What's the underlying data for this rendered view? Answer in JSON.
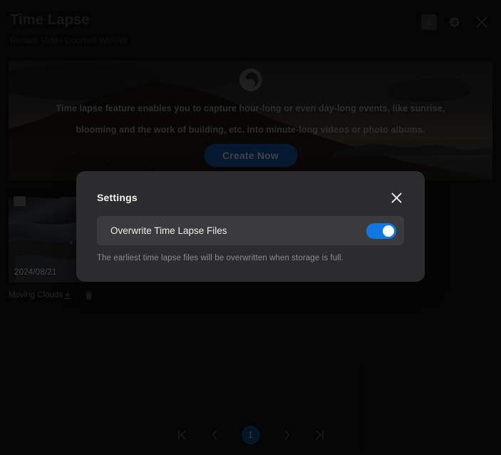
{
  "header": {
    "title": "Time Lapse",
    "subtitle": "Reolink Video Doorbell WiFi-W",
    "actions": [
      {
        "name": "download-all-icon",
        "label": "Download"
      },
      {
        "name": "settings-gear-icon",
        "label": "Settings"
      },
      {
        "name": "close-icon",
        "label": "Close"
      }
    ]
  },
  "banner": {
    "description": "Time lapse feature enables you to capture hour-long or even day-long events, like sunrise, blooming and the work of building, etc. into minute-long videos or photo albums.",
    "create_button": "Create Now",
    "logo_alt": "reolink-logo"
  },
  "gallery": {
    "items": [
      {
        "date": "2024/08/21",
        "title": "Moving Clouds",
        "download_label": "Download",
        "delete_label": "Delete"
      }
    ]
  },
  "pagination": {
    "first_label": "First page",
    "prev_label": "Previous page",
    "current_page": "1",
    "next_label": "Next page",
    "last_label": "Last page"
  },
  "settings_modal": {
    "title": "Settings",
    "close_label": "Close",
    "option_label": "Overwrite Time Lapse Files",
    "toggle_state": "on",
    "hint": "The earliest time lapse files will be overwritten when storage is full."
  },
  "colors": {
    "page_background": "#0c0c0d",
    "modal_background": "#2c2c2e",
    "row_background": "#3b3b3d",
    "toggle_on": "#1277e0",
    "accent_blue": "#0f3566",
    "page_pill": "#0b2d57"
  }
}
